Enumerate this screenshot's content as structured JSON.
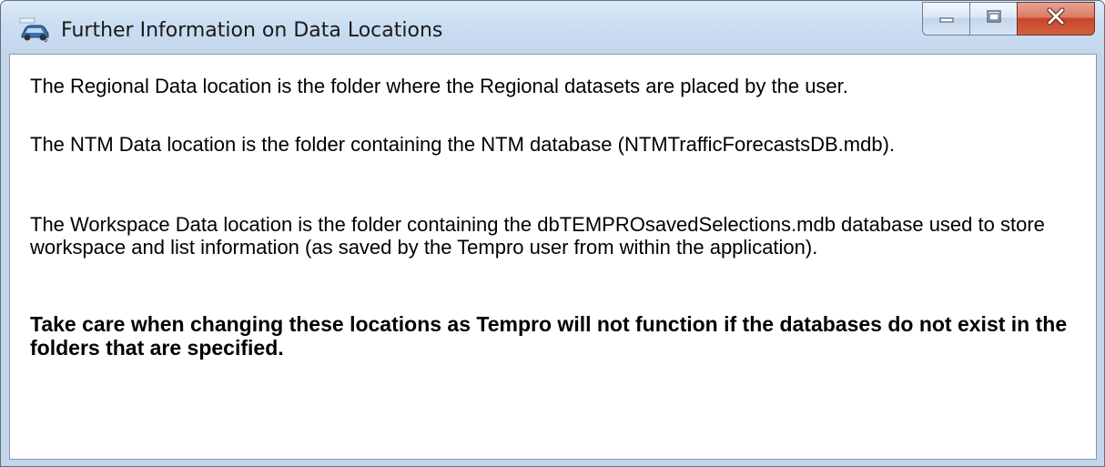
{
  "window": {
    "title": "Further Information on Data Locations",
    "app_icon": "tempro-car-icon",
    "controls": {
      "minimize_icon": "minimize-icon",
      "maximize_icon": "maximize-icon",
      "close_icon": "close-icon"
    },
    "colors": {
      "title_bar": "#c9dcf1",
      "close_button": "#c8452a"
    }
  },
  "content": {
    "paragraphs": [
      "The Regional Data location is the folder where the Regional datasets are placed by the user.",
      "The NTM Data location is the folder containing the NTM database (NTMTrafficForecastsDB.mdb).",
      "The Workspace Data location is the folder containing the dbTEMPROsavedSelections.mdb database used to store workspace and list information (as saved by the Tempro user from within the application).",
      "Take care when changing these locations as Tempro will not function if the databases do not exist in the folders that are specified."
    ]
  }
}
